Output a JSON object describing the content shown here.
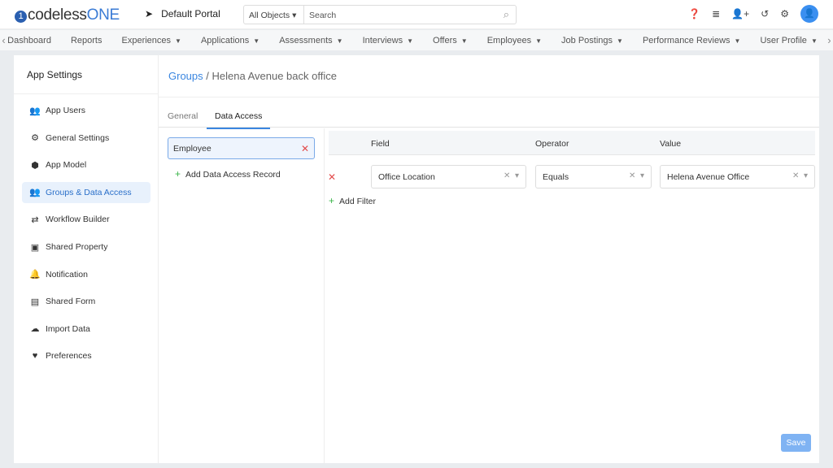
{
  "app": {
    "logo_text": "codeless",
    "logo_accent": "ONE",
    "portal": "Default Portal"
  },
  "search": {
    "scope": "All Objects",
    "placeholder": "Search"
  },
  "nav": [
    "Dashboard",
    "Reports",
    "Experiences",
    "Applications",
    "Assessments",
    "Interviews",
    "Offers",
    "Employees",
    "Job Postings",
    "Performance Reviews",
    "User Profile"
  ],
  "nav_dropdown": [
    false,
    false,
    true,
    true,
    true,
    true,
    true,
    true,
    true,
    true,
    true
  ],
  "sidebar": {
    "title": "App Settings",
    "items": [
      {
        "label": "App Users",
        "icon": "users-icon"
      },
      {
        "label": "General Settings",
        "icon": "gear-icon"
      },
      {
        "label": "App Model",
        "icon": "cube-icon"
      },
      {
        "label": "Groups & Data Access",
        "icon": "group-icon",
        "active": true
      },
      {
        "label": "Workflow Builder",
        "icon": "arrows-icon"
      },
      {
        "label": "Shared Property",
        "icon": "box-icon"
      },
      {
        "label": "Notification",
        "icon": "bell-icon"
      },
      {
        "label": "Shared Form",
        "icon": "form-icon"
      },
      {
        "label": "Import Data",
        "icon": "cloud-upload-icon"
      },
      {
        "label": "Preferences",
        "icon": "hand-user-icon"
      }
    ]
  },
  "breadcrumb": {
    "parent": "Groups",
    "separator": " / ",
    "current": "Helena Avenue back office"
  },
  "tabs": {
    "general": "General",
    "data_access": "Data Access"
  },
  "records": {
    "selected": "Employee",
    "add": "Add Data Access Record"
  },
  "filters": {
    "headers": {
      "field": "Field",
      "operator": "Operator",
      "value": "Value"
    },
    "row": {
      "field": "Office Location",
      "operator": "Equals",
      "value": "Helena Avenue Office"
    },
    "add": "Add Filter"
  },
  "save": "Save",
  "colors": {
    "accent": "#3a86e0",
    "remove": "#e24b4b",
    "add": "#3bb54a"
  }
}
